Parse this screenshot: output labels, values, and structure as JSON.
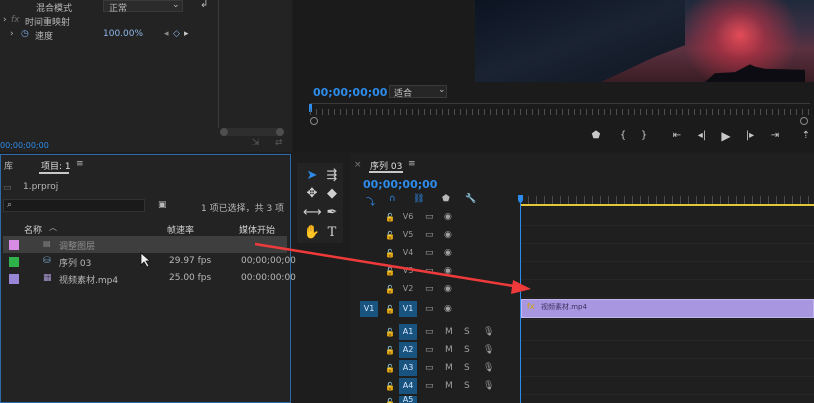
{
  "effect_controls": {
    "blend_mode_label": "混合模式",
    "blend_mode_value": "正常",
    "time_remap_label": "时间重映射",
    "fx_badge": "fx",
    "speed_label": "速度",
    "speed_value": "100.00%",
    "timecode": "00;00;00;00"
  },
  "program": {
    "timecode": "00;00;00;00",
    "fit_label": "适合"
  },
  "project": {
    "tab_library": "库",
    "tab_project": "项目: 1",
    "menu_glyph": "≡",
    "file_name": "1.prproj",
    "selection_info": "1 项已选择，共 3 项",
    "col_name": "名称",
    "col_framerate": "帧速率",
    "col_media_start": "媒体开始",
    "items": [
      {
        "name": "调整图层",
        "fps": "",
        "start": "",
        "color": "#d88be3"
      },
      {
        "name": "序列 03",
        "fps": "29.97 fps",
        "start": "00;00;00;00",
        "color": "#2fb24a"
      },
      {
        "name": "视频素材.mp4",
        "fps": "25.00 fps",
        "start": "00:00:00:00",
        "color": "#9a86d6"
      }
    ]
  },
  "timeline": {
    "seq_tab": "序列 03",
    "menu_glyph": "≡",
    "timecode": "00;00;00;00",
    "clip_name": "视频素材.mp4",
    "video_tracks": [
      "V6",
      "V5",
      "V4",
      "V3",
      "V2",
      "V1"
    ],
    "audio_tracks": [
      "A1",
      "A2",
      "A3",
      "A4",
      "A5"
    ],
    "source_v1": "V1",
    "mute": "M",
    "solo": "S",
    "colors": {
      "clip": "#a996e0",
      "accent": "#2d8ceb",
      "workarea": "#e3c53a",
      "arrow": "#ee3a3a"
    }
  }
}
